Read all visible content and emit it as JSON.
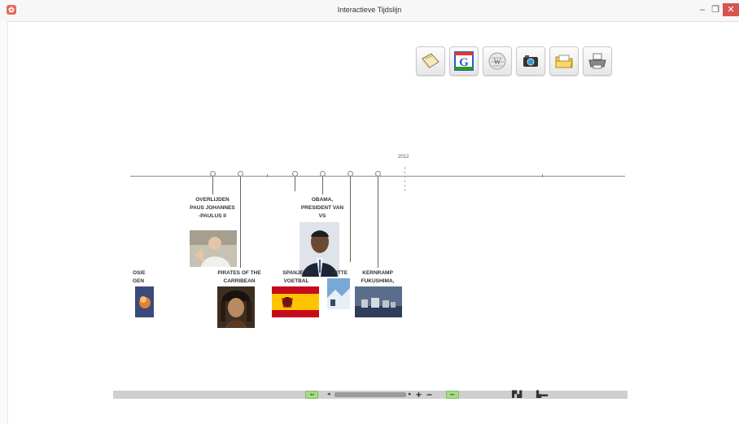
{
  "window": {
    "title": "Interactieve Tijdslijn",
    "app_icon": "timeline-app-icon",
    "min": "–",
    "max": "❐",
    "close": "✕"
  },
  "toolbar": {
    "tools": [
      {
        "name": "notebook-icon"
      },
      {
        "name": "google-search-icon"
      },
      {
        "name": "wikipedia-icon"
      },
      {
        "name": "camera-icon"
      },
      {
        "name": "folder-icon"
      },
      {
        "name": "printer-icon"
      }
    ]
  },
  "timeline": {
    "year_label": "2012",
    "events": [
      {
        "label": "OVERLIJDEN PAUS JOHANNES -PAULUS II",
        "lines": [
          "OVERLIJDEN",
          "PAUS JOHANNES",
          "-PAULUS II"
        ]
      },
      {
        "label": "PIRATES OF THE CARRIBEAN",
        "lines": [
          "PIRATES OF THE",
          "CARRIBEAN"
        ]
      },
      {
        "label": "OBAMA, PRESIDENT VAN VS",
        "lines": [
          "OBAMA,",
          "PRESIDENT VAN",
          "VS"
        ]
      },
      {
        "label": "SPANJE W... VOETBAL",
        "lines": [
          "SPANJE W",
          "VOETBAL"
        ]
      },
      {
        "label": "WITTE",
        "lines": [
          "WITTE"
        ]
      },
      {
        "label": "KERNRAMP FUKUSHIMA,",
        "lines": [
          "KERNRAMP",
          "FUKUSHIMA,"
        ]
      },
      {
        "label": "OSIE GEN",
        "lines": [
          "OSIE",
          "GEN"
        ]
      }
    ]
  },
  "bottombar": {
    "left_green": "◂◂",
    "right_green": "▸▸",
    "arrow_left": "◂",
    "arrow_right": "▸",
    "zoom_in": "+",
    "zoom_out": "−",
    "icon1": "▛▟",
    "icon2": "▙▬"
  }
}
